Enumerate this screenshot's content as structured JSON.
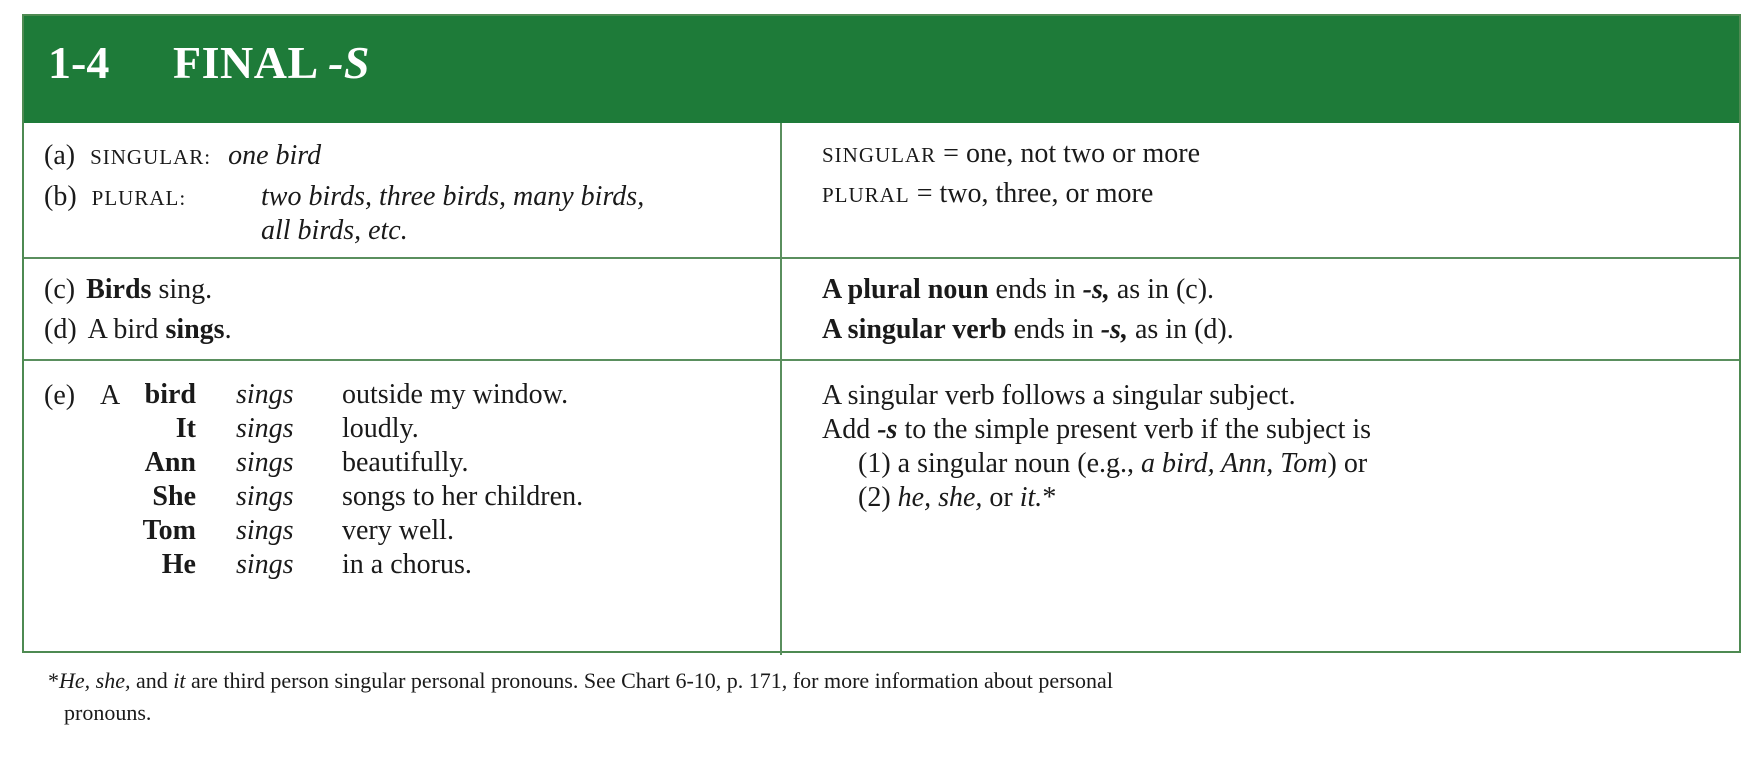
{
  "header": {
    "number": "1-4",
    "title_main": "FINAL",
    "title_suffix": "-S"
  },
  "row1": {
    "left": {
      "a_label": "(a)",
      "a_key": "SINGULAR:",
      "a_value": "one bird",
      "b_label": "(b)",
      "b_key": "PLURAL:",
      "b_value_1": "two birds, three birds, many birds,",
      "b_value_2": "all birds, etc."
    },
    "right": {
      "singular_key": "SINGULAR",
      "singular_def": "= one, not two or more",
      "plural_key": "PLURAL",
      "plural_def": "= two, three, or more"
    }
  },
  "row2": {
    "left": {
      "c_label": "(c)",
      "c_bold": "Birds",
      "c_rest": " sing.",
      "d_label": "(d)",
      "d_pre": "A bird ",
      "d_bold": "sings",
      "d_rest": "."
    },
    "right": {
      "line1_bold": "A plural noun",
      "line1_mid": " ends in ",
      "line1_s": "-s,",
      "line1_end": " as in (c).",
      "line2_bold": "A singular verb",
      "line2_mid": " ends in ",
      "line2_s": "-s,",
      "line2_end": " as in (d)."
    }
  },
  "row3": {
    "e_label": "(e)",
    "sentences": [
      {
        "article": "A",
        "subject": "bird",
        "verb": "sings",
        "rest": "outside my window."
      },
      {
        "article": "",
        "subject": "It",
        "verb": "sings",
        "rest": "loudly."
      },
      {
        "article": "",
        "subject": "Ann",
        "verb": "sings",
        "rest": "beautifully."
      },
      {
        "article": "",
        "subject": "She",
        "verb": "sings",
        "rest": "songs to her children."
      },
      {
        "article": "",
        "subject": "Tom",
        "verb": "sings",
        "rest": "very well."
      },
      {
        "article": "",
        "subject": "He",
        "verb": "sings",
        "rest": "in a chorus."
      }
    ],
    "right": {
      "line1": "A singular verb follows a singular subject.",
      "line2_pre": "Add ",
      "line2_s": "-s",
      "line2_end": " to the simple present verb if the subject is",
      "line3_pre": "(1) a singular noun (e.g., ",
      "line3_ex": "a bird, Ann, Tom",
      "line3_end": ") or",
      "line4_pre": "(2) ",
      "line4_ex": "he, she,",
      "line4_mid": " or ",
      "line4_it": "it.",
      "line4_star": "*"
    }
  },
  "footnote": {
    "star": "*",
    "he_she": "He, she,",
    "and": " and ",
    "it": "it",
    "rest1": " are third person singular personal pronouns.  See Chart 6-10, p. 171, for more information about personal",
    "rest2": "pronouns."
  }
}
